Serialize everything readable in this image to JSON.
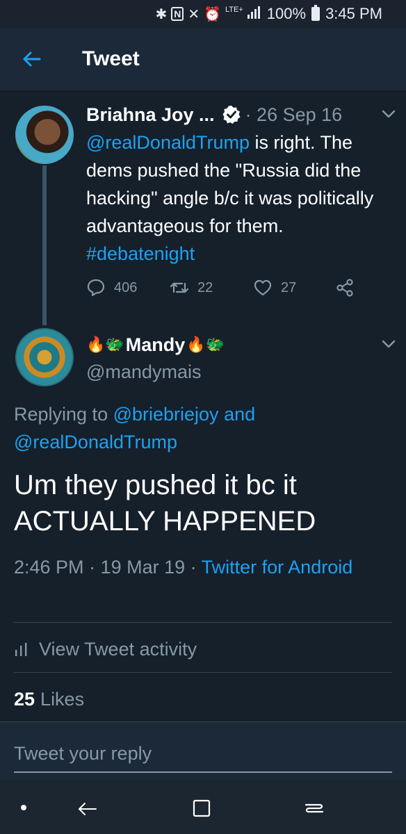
{
  "status_bar": {
    "icons": [
      "bluetooth-icon",
      "nfc-icon",
      "mute-icon",
      "alarm-icon",
      "lte-icon",
      "signal-icon",
      "battery-icon"
    ],
    "network": "LTE+",
    "battery": "100%",
    "time": "3:45 PM"
  },
  "header": {
    "title": "Tweet",
    "back_icon": "arrow-left-icon"
  },
  "parent_tweet": {
    "name": "Briahna Joy ...",
    "verified": true,
    "date": "· 26 Sep 16",
    "text_mention": "@realDonaldTrump",
    "text_body": " is right. The dems pushed the \"Russia did the hacking\" angle b/c it was politically advantageous for them. ",
    "text_hashtag": "#debatenight",
    "replies": "406",
    "retweets": "22",
    "likes": "27"
  },
  "reply_tweet": {
    "name": "Mandy",
    "name_prefix_emoji": "🔥🐲",
    "name_suffix_emoji": "🔥🐲",
    "handle": "@mandymais",
    "replying_label": "Replying to ",
    "replying_to_1": "@briebriejoy",
    "replying_and": " and",
    "replying_to_2": "@realDonaldTrump",
    "text": "Um they pushed it bc it ACTUALLY HAPPENED",
    "time": "2:46 PM",
    "date": " · 19 Mar 19 · ",
    "source": "Twitter for Android"
  },
  "activity": {
    "label": "View Tweet activity"
  },
  "likes_row": {
    "count": "25",
    "label": "Likes"
  },
  "reply_box": {
    "placeholder": "Tweet your reply"
  },
  "colors": {
    "background": "#15202b",
    "header": "#1c2938",
    "accent": "#1da1f2",
    "secondary_text": "#8899a6",
    "divider": "#38444d"
  }
}
